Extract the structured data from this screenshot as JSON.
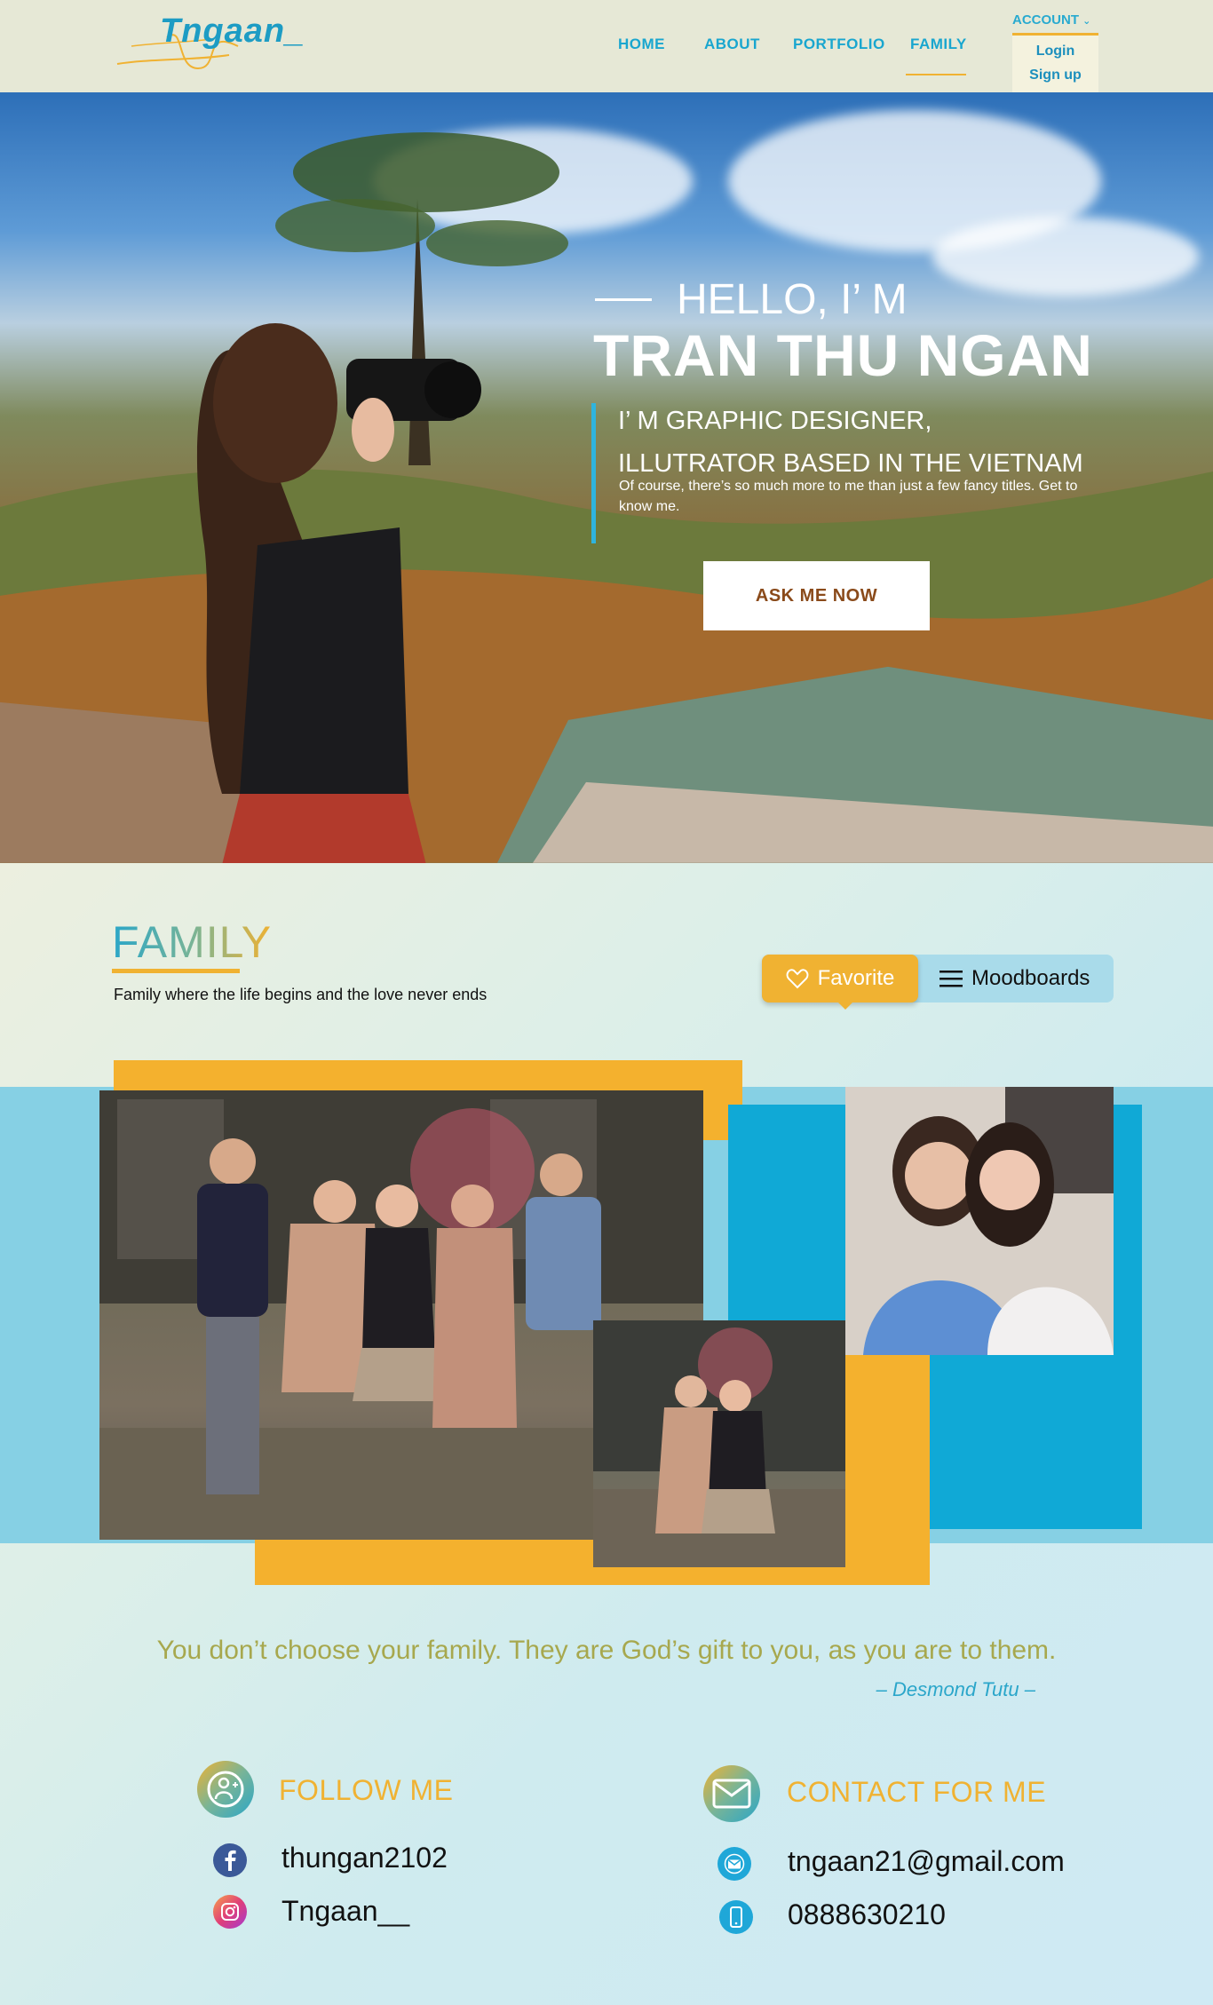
{
  "header": {
    "logo_text": "Tngaan_",
    "nav": [
      {
        "label": "HOME"
      },
      {
        "label": "ABOUT"
      },
      {
        "label": "PORTFOLIO"
      },
      {
        "label": "FAMILY"
      }
    ],
    "account": {
      "label": "ACCOUNT",
      "items": [
        "Login",
        "Sign up"
      ]
    }
  },
  "hero": {
    "hello": "HELLO, I’ M",
    "name": "TRAN THU NGAN",
    "role_line1": "I’ M GRAPHIC DESIGNER,",
    "role_line2": "ILLUTRATOR BASED IN THE VIETNAM",
    "description": "Of course, there’s so much more to me than just a few fancy titles. Get to know me.",
    "button_label": "ASK ME NOW"
  },
  "family": {
    "title": "FAMILY",
    "subtitle": "Family where the life begins and the love never ends",
    "toggle": {
      "favorite": "Favorite",
      "moodboards": "Moodboards"
    }
  },
  "quote": {
    "text": "You don’t choose your family. They are God’s gift to you, as you are to them.",
    "author": "– Desmond Tutu –"
  },
  "follow": {
    "title": "FOLLOW ME",
    "facebook": "thungan2102",
    "instagram": "Tngaan__"
  },
  "contact": {
    "title": "CONTACT FOR ME",
    "email": "tngaan21@gmail.com",
    "phone": "0888630210"
  },
  "colors": {
    "accent_orange": "#f0b232",
    "accent_blue": "#1d9cc4",
    "header_bg": "#e6e8d6"
  }
}
